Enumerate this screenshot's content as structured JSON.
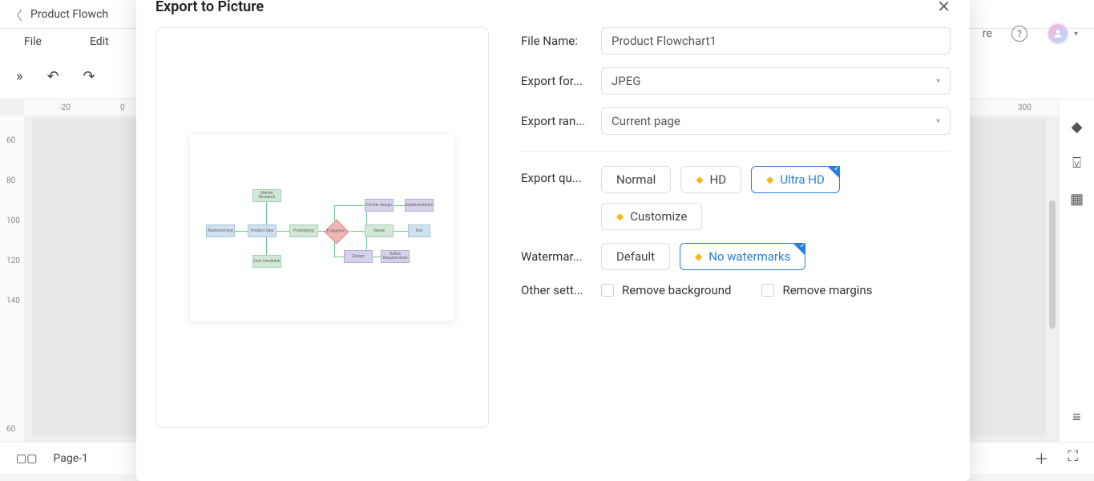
{
  "app": {
    "doc_title": "Product Flowch",
    "menu": {
      "file": "File",
      "edit": "Edit"
    },
    "ruler_h": {
      "m20": "-20",
      "zero": "0",
      "p300": "300"
    },
    "ruler_v": {
      "r60a": "60",
      "r80": "80",
      "r100": "100",
      "r120": "120",
      "r140": "140",
      "r60b": "60"
    },
    "page_label": "Page-1",
    "topright_text": "re"
  },
  "modal": {
    "title": "Export to Picture",
    "labels": {
      "file_name": "File Name:",
      "export_format": "Export for...",
      "export_range": "Export ran...",
      "export_quality": "Export qu...",
      "watermark": "Watermar...",
      "other": "Other sett..."
    },
    "file_name_value": "Product Flowchart1",
    "format_value": "JPEG",
    "range_value": "Current page",
    "quality": {
      "normal": "Normal",
      "hd": "HD",
      "ultra": "Ultra HD",
      "customize": "Customize"
    },
    "watermark": {
      "default": "Default",
      "none": "No watermarks"
    },
    "other_opts": {
      "remove_bg": "Remove background",
      "remove_margins": "Remove margins"
    }
  },
  "flowchart_nodes": {
    "brainstorm": "Brainstorming",
    "market": "Market Research",
    "product_idea": "Product Idea",
    "user_fb": "User Feedback",
    "prototype": "Prototyping",
    "evaluation": "Evaluation",
    "design": "Design",
    "further": "Further design",
    "refine": "Refine Requirements",
    "impl": "Implementation",
    "iterate": "Iterate",
    "end": "End"
  }
}
